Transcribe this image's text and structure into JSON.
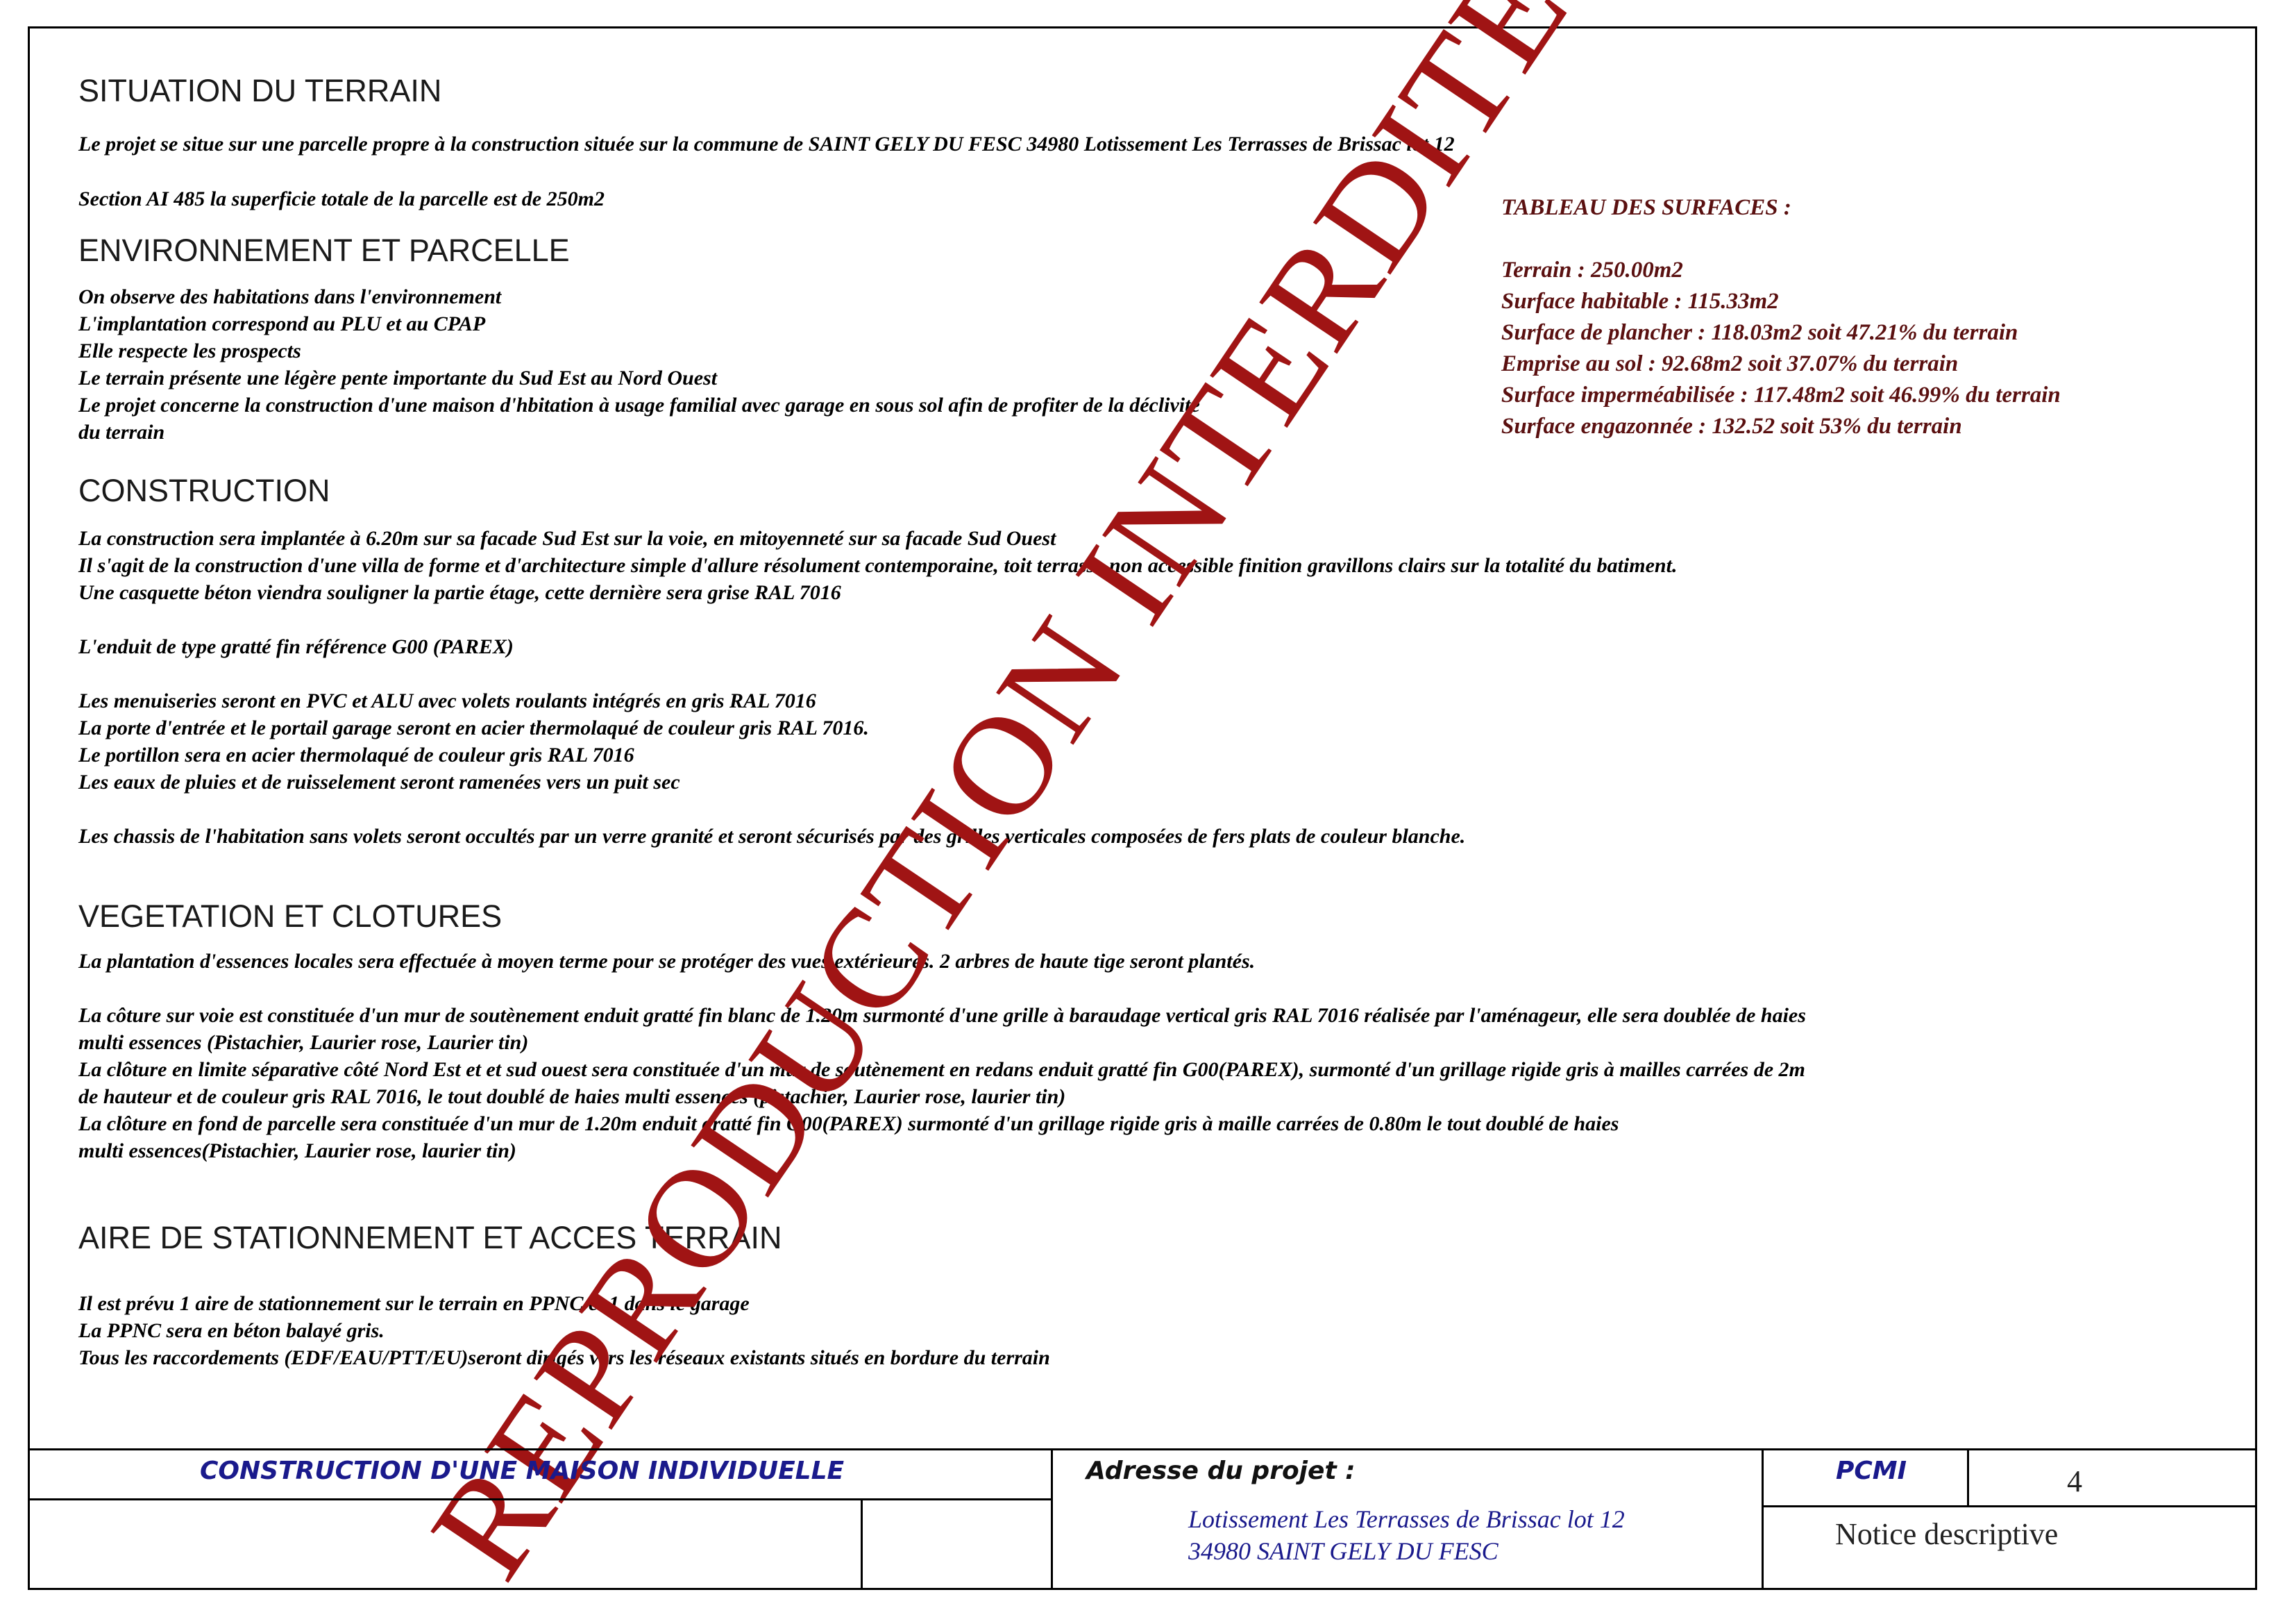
{
  "sections": {
    "situation": {
      "title": "SITUATION DU TERRAIN",
      "line1": "Le projet se situe sur une parcelle propre à la construction située sur la commune de SAINT GELY DU FESC 34980 Lotissement Les Terrasses de Brissac lot 12",
      "line2": "Section AI 485 la superficie totale de la parcelle est de 250m2"
    },
    "environnement": {
      "title": "ENVIRONNEMENT ET PARCELLE",
      "lines": [
        "On observe des habitations dans l'environnement",
        "L'implantation correspond au PLU et au CPAP",
        "Elle respecte les prospects",
        "Le terrain présente une légère pente importante du Sud Est au Nord Ouest",
        "Le projet concerne la construction d'une maison d'hbitation à usage familial  avec garage en sous sol afin de profiter de la déclivité",
        "du terrain"
      ]
    },
    "construction": {
      "title": "CONSTRUCTION",
      "lines": [
        "La construction sera implantée à 6.20m sur sa facade Sud Est sur  la voie, en mitoyenneté sur sa facade Sud Ouest",
        "Il s'agit de la construction d'une villa de forme et d'architecture simple d'allure résolument contemporaine, toit terrasse non accessible finition gravillons clairs sur la totalité du batiment.",
        "Une casquette béton viendra souligner la partie étage, cette dernière sera grise RAL 7016",
        "",
        "L'enduit de type gratté  fin référence G00 (PAREX)",
        "",
        "Les menuiseries seront en PVC et ALU avec volets roulants intégrés en gris RAL 7016",
        "La porte d'entrée et le portail garage seront en acier thermolaqué de couleur gris RAL 7016.",
        "Le portillon sera en acier thermolaqué de couleur gris RAL 7016",
        "Les eaux de pluies et de ruisselement seront ramenées vers un puit sec",
        "",
        "Les chassis de l'habitation sans volets seront occultés par un verre granité et seront sécurisés par des grilles verticales composées de fers plats de couleur blanche."
      ]
    },
    "vegetation": {
      "title": "VEGETATION ET CLOTURES",
      "lines": [
        "La plantation d'essences locales sera effectuée à moyen terme pour se protéger des vues extérieures. 2 arbres de haute tige seront plantés.",
        "",
        "La côture sur  voie est constituée d'un mur de soutènement enduit gratté fin blanc de 1.20m surmonté d'une grille à baraudage vertical gris RAL 7016 réalisée par l'aménageur, elle sera doublée de haies",
        "multi essences (Pistachier, Laurier rose, Laurier tin)",
        "La clôture en limite séparative côté Nord Est et et sud ouest sera constituée d'un mur de soutènement en redans enduit gratté fin G00(PAREX), surmonté d'un grillage rigide gris à mailles carrées de 2m",
        "de hauteur et de couleur gris RAL 7016, le tout doublé de haies multi essences (pistachier, Laurier rose, laurier tin)",
        "La clôture en fond de parcelle sera constituée d'un mur de 1.20m enduit gratté fin G00(PAREX) surmonté d'un grillage rigide gris à maille carrées de 0.80m le tout doublé de haies",
        "multi essences(Pistachier, Laurier rose, laurier tin)"
      ]
    },
    "stationnement": {
      "title": "AIRE DE STATIONNEMENT ET ACCES TERRAIN",
      "lines": [
        "Il est prévu 1 aire de stationnement sur le terrain en PPNC et 1 dans le garage",
        "La PPNC sera en béton balayé gris.",
        "Tous les raccordements (EDF/EAU/PTT/EU)seront dirigés vers les réseaux existants situés en bordure du terrain"
      ]
    }
  },
  "surfaces": {
    "title": "TABLEAU DES SURFACES :",
    "terrain": "Terrain : 250.00m2",
    "habitable": "Surface habitable : 115.33m2",
    "plancher": "Surface de plancher : 118.03m2 soit 47.21% du terrain",
    "emprise": "Emprise au sol : 92.68m2 soit 37.07% du terrain",
    "impermeabilisee": "Surface imperméabilisée : 117.48m2 soit 46.99% du terrain",
    "engazonnee": "Surface engazonnée : 132.52 soit 53% du terrain"
  },
  "watermark": "REPRODUCTION INTERDITE",
  "title_block": {
    "project_title": "CONSTRUCTION D'UNE MAISON INDIVIDUELLE",
    "address_label": "Adresse du projet :",
    "address_line1": "Lotissement Les Terrasses de Brissac lot 12",
    "address_line2": "34980 SAINT GELY DU FESC",
    "doc_code": "PCMI",
    "page_number": "4",
    "doc_title": "Notice descriptive"
  },
  "colors": {
    "watermark": "#a01414",
    "surfaces_text": "#5a1010",
    "title_block_blue": "#1a1a8c"
  }
}
